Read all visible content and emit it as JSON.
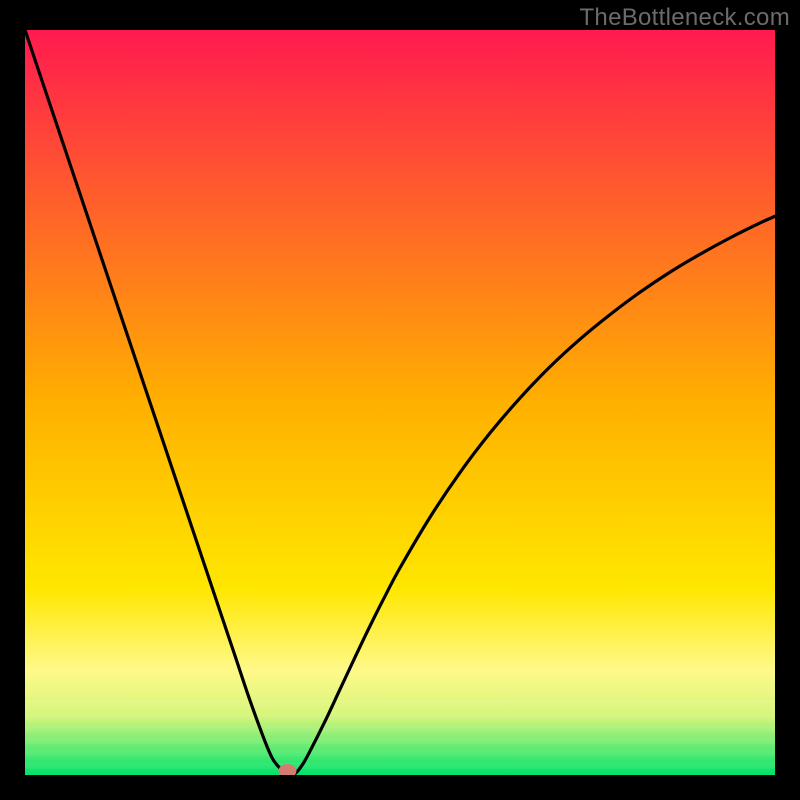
{
  "watermark": "TheBottleneck.com",
  "chart_data": {
    "type": "line",
    "title": "",
    "xlabel": "",
    "ylabel": "",
    "xlim": [
      0,
      100
    ],
    "ylim": [
      0,
      100
    ],
    "series": [
      {
        "name": "curve",
        "x": [
          0,
          2,
          4,
          6,
          8,
          10,
          12,
          14,
          16,
          18,
          20,
          22,
          24,
          26,
          28,
          30,
          32,
          33,
          34,
          35,
          36,
          37,
          38,
          40,
          42,
          44,
          46,
          48,
          50,
          54,
          58,
          62,
          66,
          70,
          74,
          78,
          82,
          86,
          90,
          94,
          98,
          100
        ],
        "values": [
          100,
          94,
          88,
          82,
          76,
          70,
          64,
          58,
          52,
          46,
          40,
          34,
          28,
          22,
          16,
          10,
          4.5,
          2.2,
          0.9,
          0.1,
          0.2,
          1.4,
          3.2,
          7.2,
          11.5,
          15.8,
          20.0,
          24.0,
          27.8,
          34.6,
          40.6,
          45.9,
          50.6,
          54.8,
          58.5,
          61.8,
          64.8,
          67.5,
          69.9,
          72.1,
          74.1,
          75.0
        ]
      }
    ],
    "marker": {
      "x": 35,
      "y": 0
    },
    "gradient": {
      "stops": [
        {
          "offset": 0.0,
          "color": "#ff1a4f"
        },
        {
          "offset": 0.5,
          "color": "#ffb000"
        },
        {
          "offset": 0.75,
          "color": "#ffe700"
        },
        {
          "offset": 0.86,
          "color": "#fff98a"
        },
        {
          "offset": 0.92,
          "color": "#d6f57a"
        },
        {
          "offset": 1.0,
          "color": "#00e36b"
        }
      ]
    },
    "baseline_band_top_frac": 0.9
  }
}
